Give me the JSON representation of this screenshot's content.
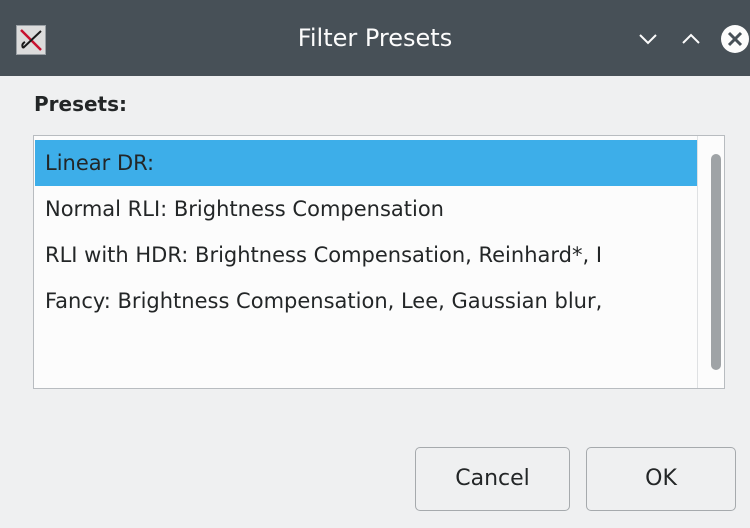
{
  "window": {
    "title": "Filter Presets",
    "app_icon": "x-logo-icon",
    "controls": [
      "minimize-icon",
      "maximize-icon",
      "close-icon"
    ]
  },
  "presets": {
    "label": "Presets:",
    "items": [
      "Linear DR:",
      "Normal RLI: Brightness Compensation",
      "RLI with HDR: Brightness Compensation, Reinhard*, I",
      "Fancy: Brightness Compensation, Lee, Gaussian blur,"
    ],
    "selected_index": 0
  },
  "buttons": {
    "cancel": "Cancel",
    "ok": "OK"
  },
  "colors": {
    "titlebar": "#475057",
    "selection": "#3daee9",
    "background": "#eff0f1"
  }
}
